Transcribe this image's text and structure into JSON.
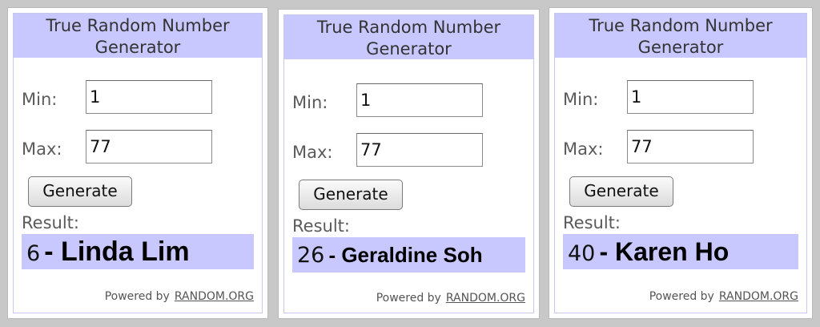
{
  "widgets": [
    {
      "title": "True Random Number Generator",
      "min_label": "Min:",
      "min_value": "1",
      "max_label": "Max:",
      "max_value": "77",
      "generate_label": "Generate",
      "result_label": "Result:",
      "result_number": "6",
      "result_name": "- Linda Lim",
      "powered_by": "Powered by",
      "powered_link": "RANDOM.ORG"
    },
    {
      "title": "True Random Number Generator",
      "min_label": "Min:",
      "min_value": "1",
      "max_label": "Max:",
      "max_value": "77",
      "generate_label": "Generate",
      "result_label": "Result:",
      "result_number": "26",
      "result_name": "- Geraldine Soh",
      "powered_by": "Powered by",
      "powered_link": "RANDOM.ORG"
    },
    {
      "title": "True Random Number Generator",
      "min_label": "Min:",
      "min_value": "1",
      "max_label": "Max:",
      "max_value": "77",
      "generate_label": "Generate",
      "result_label": "Result:",
      "result_number": "40",
      "result_name": "- Karen Ho",
      "powered_by": "Powered by",
      "powered_link": "RANDOM.ORG"
    }
  ],
  "colors": {
    "header_background": "#c8c8ff",
    "result_background": "#c8c8ff",
    "page_background": "#c8c8c8"
  }
}
